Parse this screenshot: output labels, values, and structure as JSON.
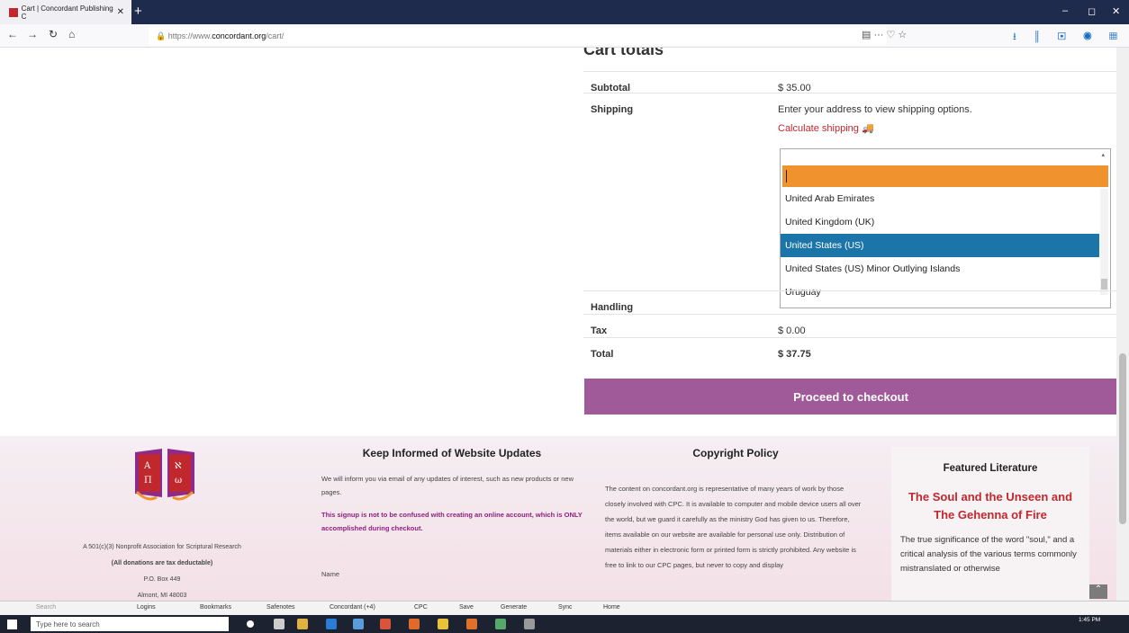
{
  "browser": {
    "tab_title": "Cart | Concordant Publishing C",
    "url_prefix": "https://www.",
    "url_domain": "concordant.org",
    "url_path": "/cart/"
  },
  "cart": {
    "title": "Cart totals",
    "subtotal_label": "Subtotal",
    "subtotal_value": "$ 35.00",
    "shipping_label": "Shipping",
    "shipping_text": "Enter your address to view shipping options.",
    "calculate_shipping": "Calculate shipping",
    "handling_label": "Handling",
    "tax_label": "Tax",
    "tax_value": "$ 0.00",
    "total_label": "Total",
    "total_value": "$ 37.75",
    "checkout_button": "Proceed to checkout"
  },
  "country_dropdown": {
    "options": [
      "United Arab Emirates",
      "United Kingdom (UK)",
      "United States (US)",
      "United States (US) Minor Outlying Islands",
      "Uruguay"
    ],
    "highlighted": "United States (US)"
  },
  "footer": {
    "org_lines": [
      "A 501(c)(3) Nonprofit Association for Scriptural Research",
      "(All donations are tax deductable)",
      "P.O. Box 449",
      "Almont, MI 48003"
    ],
    "updates_title": "Keep Informed of Website Updates",
    "updates_text": "We will inform you via email of any updates of interest, such as new products or new pages.",
    "updates_warning": "This signup is not to be confused with creating an online account, which is ONLY accomplished during checkout.",
    "name_label": "Name",
    "copyright_title": "Copyright Policy",
    "copyright_text": "The content on concordant.org is representative of many years of work by those closely involved with CPC. It is available to computer and mobile device users all over the world, but we guard it carefully as the ministry God has given to us. Therefore, items available on our website are available for personal use only. Distribution of materials either in electronic form or printed form is strictly prohibited. Any website is free to link to our CPC pages, but never to copy and display",
    "featured_title": "Featured Literature",
    "book_title": "The Soul and the Unseen and The Gehenna of Fire",
    "book_desc": "The true significance of the word \"soul,\" and a critical analysis of the various terms commonly mistranslated or otherwise"
  },
  "bookmarks": [
    "Logins",
    "Bookmarks",
    "Safenotes",
    "Concordant (+4)",
    "CPC",
    "Save",
    "Generate",
    "Sync",
    "Home"
  ],
  "taskbar": {
    "search_placeholder": "Type here to search",
    "time": "1:45 PM"
  }
}
